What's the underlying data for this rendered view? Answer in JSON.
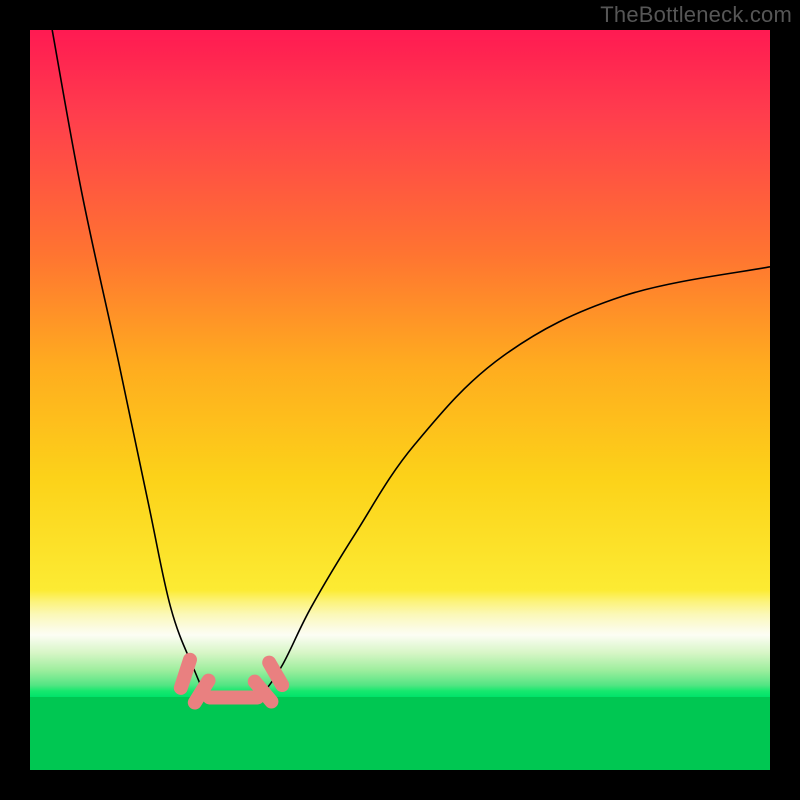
{
  "watermark": "TheBottleneck.com",
  "chart_data": {
    "type": "line",
    "title": "",
    "xlabel": "",
    "ylabel": "",
    "xlim": [
      0,
      100
    ],
    "ylim": [
      0,
      100
    ],
    "background_gradient": [
      {
        "y": 100,
        "color": "#ff1a52"
      },
      {
        "y": 60,
        "color": "#ff7431"
      },
      {
        "y": 40,
        "color": "#ffc028"
      },
      {
        "y": 24,
        "color": "#fceb33"
      },
      {
        "y": 18,
        "color": "#fbfbe3"
      },
      {
        "y": 11,
        "color": "#54e584"
      },
      {
        "y": 9,
        "color": "#00e36a"
      },
      {
        "y": 0,
        "color": "#00c752"
      }
    ],
    "series": [
      {
        "name": "bottleneck-left",
        "x": [
          3,
          7,
          12,
          16,
          19,
          22,
          24,
          26
        ],
        "y": [
          100,
          78,
          55,
          36,
          22,
          14,
          10,
          10
        ]
      },
      {
        "name": "bottleneck-right",
        "x": [
          29,
          31,
          34,
          38,
          44,
          52,
          64,
          80,
          100
        ],
        "y": [
          10,
          10,
          14,
          22,
          32,
          44,
          56,
          64,
          68
        ]
      }
    ],
    "markers": [
      {
        "name": "marker-left-upper",
        "x": 21.0,
        "y": 13.0,
        "len": 4,
        "angle": 72
      },
      {
        "name": "marker-left-lower",
        "x": 23.2,
        "y": 10.6,
        "len": 3.5,
        "angle": 58
      },
      {
        "name": "marker-bottom",
        "x": 27.5,
        "y": 9.8,
        "len": 6.5,
        "angle": 0
      },
      {
        "name": "marker-right-lower",
        "x": 31.5,
        "y": 10.6,
        "len": 3.5,
        "angle": -50
      },
      {
        "name": "marker-right-upper",
        "x": 33.2,
        "y": 13.0,
        "len": 3.5,
        "angle": -60
      }
    ]
  }
}
